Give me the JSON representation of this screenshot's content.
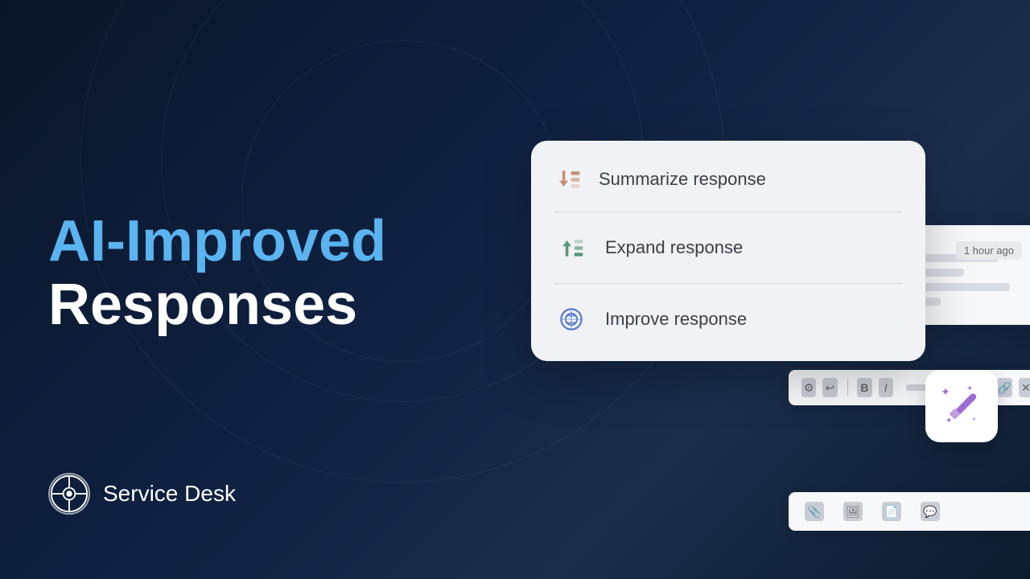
{
  "background": {
    "color": "#0d1b2e"
  },
  "hero": {
    "title_line1": "AI-Improved",
    "title_line2": "Responses"
  },
  "brand": {
    "name": "Service Desk"
  },
  "menu": {
    "items": [
      {
        "id": "summarize",
        "label": "Summarize response",
        "icon": "summarize-icon"
      },
      {
        "id": "expand",
        "label": "Expand response",
        "icon": "expand-icon"
      },
      {
        "id": "improve",
        "label": "Improve response",
        "icon": "improve-icon"
      }
    ]
  },
  "chat": {
    "timestamp": "1 hour ago"
  },
  "magic_button": {
    "label": "✨🪄"
  }
}
